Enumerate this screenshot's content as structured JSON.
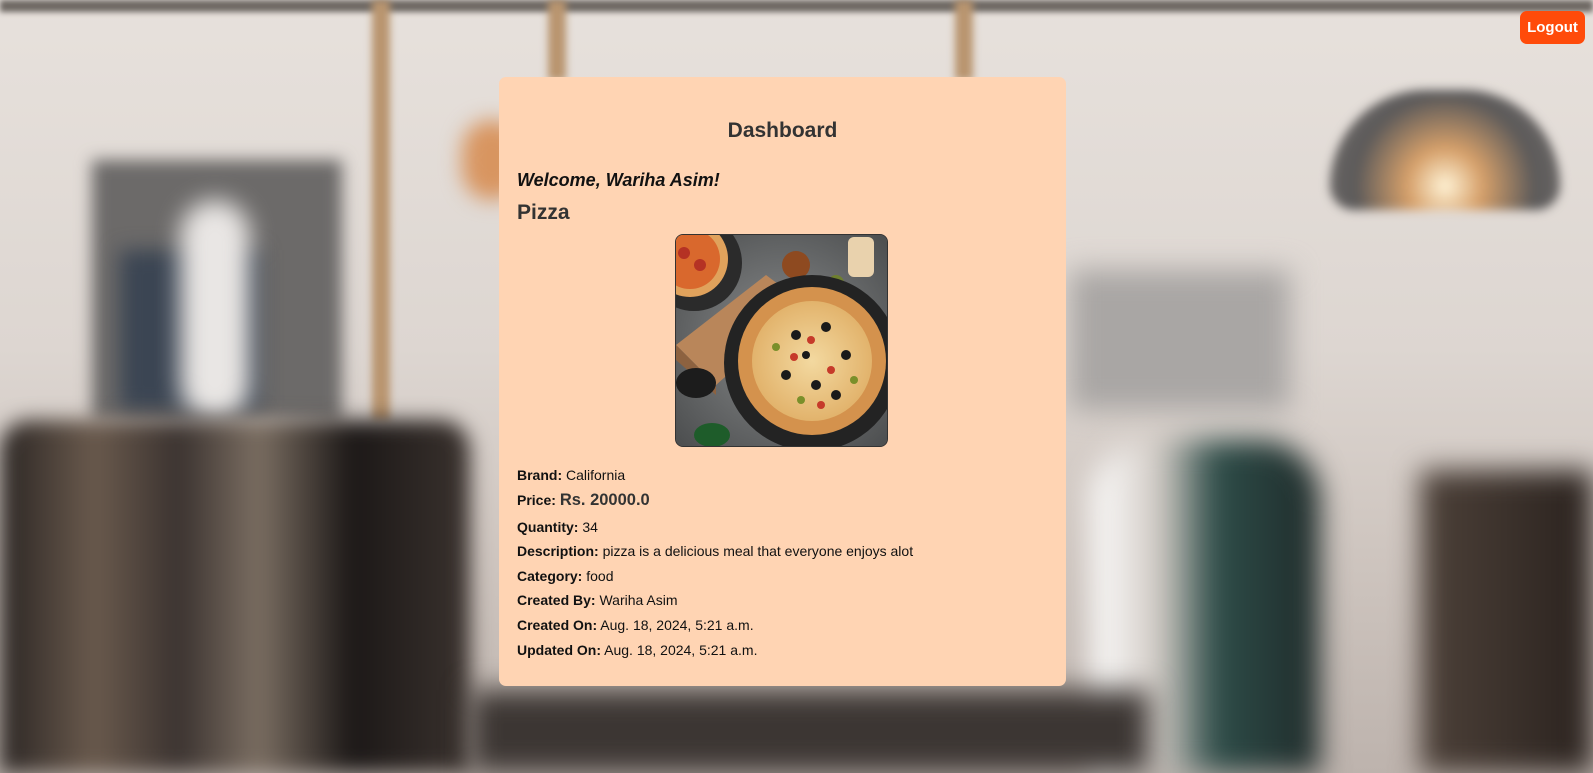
{
  "header": {
    "logout_label": "Logout"
  },
  "dashboard": {
    "title": "Dashboard",
    "welcome": "Welcome, Wariha Asim!",
    "product": {
      "name": "Pizza",
      "image_alt": "pizza-photo",
      "fields": {
        "brand": {
          "label": "Brand:",
          "value": "California"
        },
        "price": {
          "label": "Price:",
          "value": "Rs. 20000.0"
        },
        "quantity": {
          "label": "Quantity:",
          "value": "34"
        },
        "description": {
          "label": "Description:",
          "value": "pizza is a delicious meal that everyone enjoys alot"
        },
        "category": {
          "label": "Category:",
          "value": "food"
        },
        "created_by": {
          "label": "Created By:",
          "value": "Wariha Asim"
        },
        "created_on": {
          "label": "Created On:",
          "value": "Aug. 18, 2024, 5:21 a.m."
        },
        "updated_on": {
          "label": "Updated On:",
          "value": "Aug. 18, 2024, 5:21 a.m."
        }
      }
    }
  },
  "colors": {
    "card_bg": "#ffd4b3",
    "logout_bg": "#ff4b0a",
    "text": "#222222"
  }
}
